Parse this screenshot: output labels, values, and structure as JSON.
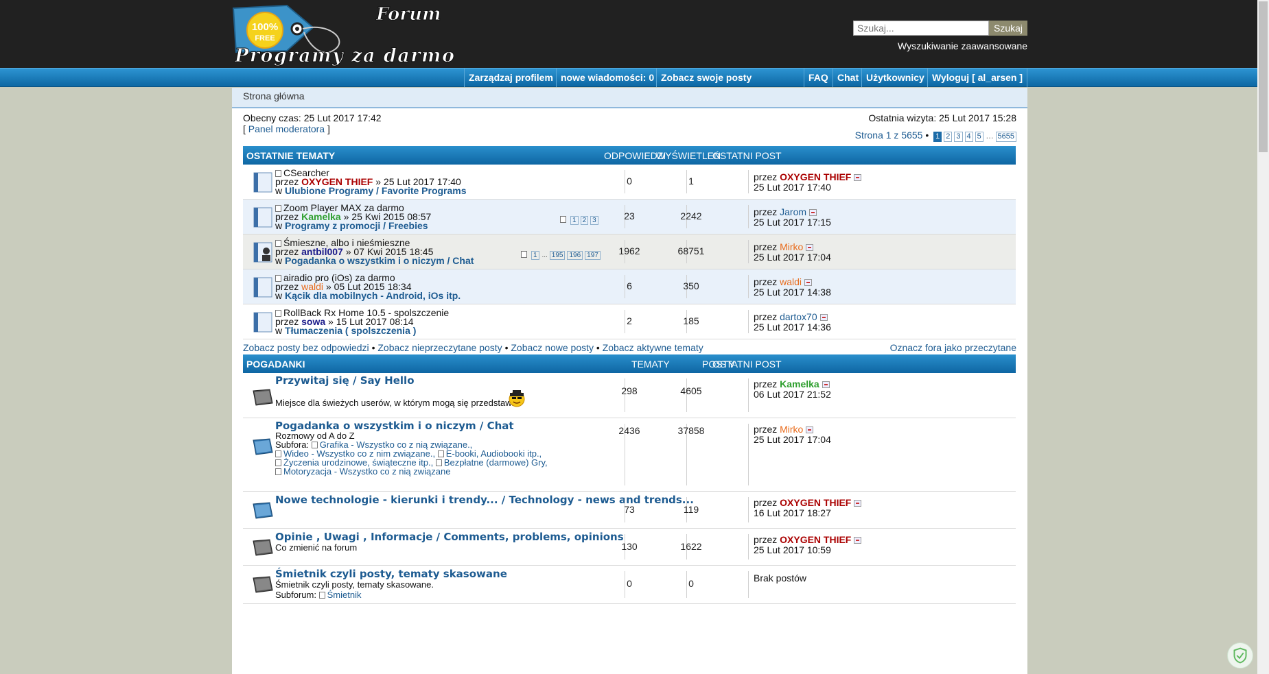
{
  "header": {
    "logo_forum": "Forum",
    "logo_badge_top": "100%",
    "logo_badge_bottom": "FREE",
    "logo_name": "Programy za darmo",
    "search_placeholder": "Szukaj...",
    "search_button": "Szukaj",
    "advanced_search": "Wyszukiwanie zaawansowane"
  },
  "nav": {
    "left": [
      "Zarządzaj profilem",
      "nowe wiadomości: 0",
      "Zobacz swoje posty"
    ],
    "right": [
      "FAQ",
      "Chat",
      "Użytkownicy",
      "Wyloguj [ al_arsen ]"
    ]
  },
  "breadcrumb": "Strona główna",
  "info": {
    "current_time": "Obecny czas: 25 Lut 2017 17:42",
    "last_visit": "Ostatnia wizyta: 25 Lut 2017 15:28",
    "mod_open": "[ ",
    "mod_panel": "Panel moderatora",
    "mod_close": " ]"
  },
  "pagination": {
    "label": "Strona 1 z 5655",
    "bullet": "•",
    "pages": [
      "1",
      "2",
      "3",
      "4",
      "5"
    ],
    "ellipsis": "...",
    "last": "5655"
  },
  "recent": {
    "headers": {
      "title": "OSTATNIE TEMATY",
      "replies": "ODPOWIEDZI",
      "views": "WYŚWIETLEŃ",
      "last": "OSTATNI POST"
    },
    "rows": [
      {
        "title": "CSearcher",
        "by": "przez",
        "author": "OXYGEN THIEF",
        "date": "» 25 Lut 2017 17:40",
        "in": "w",
        "forum": "Ulubione Programy / Favorite Programs",
        "replies": "0",
        "views": "1",
        "last_by": "przez",
        "last_user": "OXYGEN THIEF",
        "last_date": "25 Lut 2017 17:40"
      },
      {
        "title": "Zoom Player MAX za darmo",
        "by": "przez",
        "author": "Kamelka",
        "date": "» 25 Kwi 2015 08:57",
        "in": "w",
        "forum": "Programy z promocji / Freebies",
        "pages": [
          "1",
          "2",
          "3"
        ],
        "replies": "23",
        "views": "2242",
        "last_by": "przez",
        "last_user": "Jarom",
        "last_date": "25 Lut 2017 17:15"
      },
      {
        "title": "Śmieszne, albo i nieśmieszne",
        "by": "przez",
        "author": "antbil007",
        "date": "» 07 Kwi 2015 18:45",
        "in": "w",
        "forum": "Pogadanka o wszystkim i o niczym / Chat",
        "pages": [
          "1",
          "...",
          "195",
          "196",
          "197"
        ],
        "replies": "1962",
        "views": "68751",
        "last_by": "przez",
        "last_user": "Mirko",
        "last_date": "25 Lut 2017 17:04"
      },
      {
        "title": "airadio pro (iOs) za darmo",
        "by": "przez",
        "author": "waldi",
        "date": "» 05 Lut 2015 18:34",
        "in": "w",
        "forum": "Kącik dla mobilnych - Android, iOs itp.",
        "replies": "6",
        "views": "350",
        "last_by": "przez",
        "last_user": "waldi",
        "last_date": "25 Lut 2017 14:38"
      },
      {
        "title": "RollBack Rx Home 10.5 - spolszczenie",
        "by": "przez",
        "author": "sowa",
        "date": "» 15 Lut 2017 08:14",
        "in": "w",
        "forum": "Tłumaczenia ( spolszczenia )",
        "replies": "2",
        "views": "185",
        "last_by": "przez",
        "last_user": "dartox70",
        "last_date": "25 Lut 2017 14:36"
      }
    ]
  },
  "links": {
    "left": [
      "Zobacz posty bez odpowiedzi",
      "Zobacz nieprzeczytane posty",
      "Zobacz nowe posty",
      "Zobacz aktywne tematy"
    ],
    "bullet": "•",
    "right": "Oznacz fora jako przeczytane"
  },
  "forums": {
    "headers": {
      "title": "POGADANKI",
      "topics": "TEMATY",
      "posts": "POSTY",
      "last": "OSTATNI POST"
    },
    "rows": [
      {
        "title": "Przywitaj się / Say Hello",
        "desc": "Miejsce dla świeżych userów, w którym mogą się przedstawić.",
        "topics": "298",
        "posts": "4605",
        "last_by": "przez",
        "last_user": "Kamelka",
        "last_date": "06 Lut 2017 21:52"
      },
      {
        "title": "Pogadanka o wszystkim i o niczym / Chat",
        "desc": "Rozmowy od A do Z",
        "subforums_label": "Subfora:",
        "subforums": [
          "Grafika - Wszystko co z nią związane.,",
          "Wideo - Wszystko co z nim związane.,",
          "E-booki, Audiobooki itp.,",
          "Życzenia urodzinowe, świąteczne itp.,",
          "Bezpłatne (darmowe) Gry,",
          "Motoryzacja - Wszystko co z nią związane"
        ],
        "topics": "2436",
        "posts": "37858",
        "last_by": "przez",
        "last_user": "Mirko",
        "last_date": "25 Lut 2017 17:04"
      },
      {
        "title": "Nowe technologie - kierunki i trendy... / Technology - news and trends...",
        "topics": "73",
        "posts": "119",
        "last_by": "przez",
        "last_user": "OXYGEN THIEF",
        "last_date": "16 Lut 2017 18:27"
      },
      {
        "title": "Opinie , Uwagi , Informacje / Comments, problems, opinions",
        "desc": "Co zmienić na forum",
        "topics": "130",
        "posts": "1622",
        "last_by": "przez",
        "last_user": "OXYGEN THIEF",
        "last_date": "25 Lut 2017 10:59"
      },
      {
        "title": "Śmietnik czyli posty, tematy skasowane",
        "desc": "Śmietnik czyli posty, tematy skasowane.",
        "subforums_label": "Subforum:",
        "subforums": [
          "Śmietnik"
        ],
        "topics": "0",
        "posts": "0",
        "no_posts": "Brak postów"
      }
    ]
  }
}
